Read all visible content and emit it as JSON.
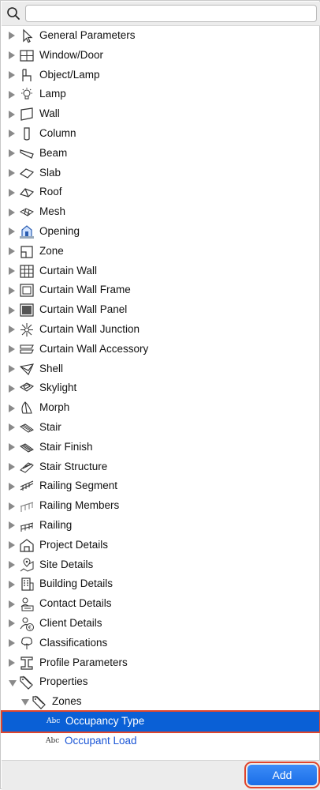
{
  "search": {
    "placeholder": "",
    "value": ""
  },
  "tree": {
    "items": [
      {
        "label": "General Parameters",
        "icon": "cursor-arrow-icon"
      },
      {
        "label": "Window/Door",
        "icon": "window-icon"
      },
      {
        "label": "Object/Lamp",
        "icon": "chair-icon"
      },
      {
        "label": "Lamp",
        "icon": "lightbulb-icon"
      },
      {
        "label": "Wall",
        "icon": "wall-icon"
      },
      {
        "label": "Column",
        "icon": "column-icon"
      },
      {
        "label": "Beam",
        "icon": "beam-icon"
      },
      {
        "label": "Slab",
        "icon": "slab-icon"
      },
      {
        "label": "Roof",
        "icon": "roof-icon"
      },
      {
        "label": "Mesh",
        "icon": "mesh-icon"
      },
      {
        "label": "Opening",
        "icon": "opening-icon"
      },
      {
        "label": "Zone",
        "icon": "zone-icon"
      },
      {
        "label": "Curtain Wall",
        "icon": "curtain-wall-icon"
      },
      {
        "label": "Curtain Wall Frame",
        "icon": "curtain-wall-frame-icon"
      },
      {
        "label": "Curtain Wall Panel",
        "icon": "curtain-wall-panel-icon"
      },
      {
        "label": "Curtain Wall Junction",
        "icon": "curtain-wall-junction-icon"
      },
      {
        "label": "Curtain Wall Accessory",
        "icon": "curtain-wall-accessory-icon"
      },
      {
        "label": "Shell",
        "icon": "shell-icon"
      },
      {
        "label": "Skylight",
        "icon": "skylight-icon"
      },
      {
        "label": "Morph",
        "icon": "morph-icon"
      },
      {
        "label": "Stair",
        "icon": "stair-icon"
      },
      {
        "label": "Stair Finish",
        "icon": "stair-finish-icon"
      },
      {
        "label": "Stair Structure",
        "icon": "stair-structure-icon"
      },
      {
        "label": "Railing Segment",
        "icon": "railing-segment-icon"
      },
      {
        "label": "Railing Members",
        "icon": "railing-members-icon"
      },
      {
        "label": "Railing",
        "icon": "railing-icon"
      },
      {
        "label": "Project Details",
        "icon": "house-icon"
      },
      {
        "label": "Site Details",
        "icon": "map-pin-icon"
      },
      {
        "label": "Building Details",
        "icon": "building-icon"
      },
      {
        "label": "Contact Details",
        "icon": "contact-card-icon"
      },
      {
        "label": "Client Details",
        "icon": "client-euro-icon"
      },
      {
        "label": "Classifications",
        "icon": "tree-icon"
      },
      {
        "label": "Profile Parameters",
        "icon": "i-beam-profile-icon"
      }
    ],
    "properties": {
      "label": "Properties",
      "icon": "tag-icon"
    },
    "zones": {
      "label": "Zones",
      "icon": "tag-icon"
    },
    "leaves": [
      {
        "type_label": "Abc",
        "label": "Occupancy Type",
        "selected": true
      },
      {
        "type_label": "Abc",
        "label": "Occupant Load",
        "selected": false
      }
    ]
  },
  "footer": {
    "add_label": "Add"
  },
  "colors": {
    "selection": "#0a60d6",
    "highlight": "#e0452c",
    "link": "#1a55d6"
  }
}
